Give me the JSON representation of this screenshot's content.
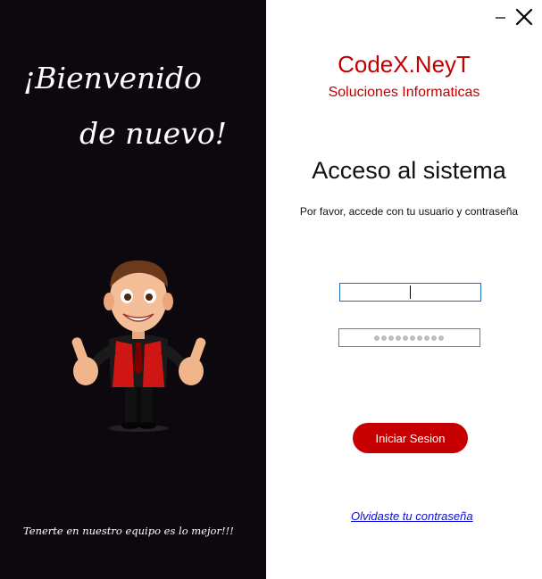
{
  "welcome": {
    "line1": "¡Bienvenido",
    "line2": "de nuevo!"
  },
  "tagline": "Tenerte en nuestro equipo es lo mejor!!!",
  "window": {
    "minimize_icon": "minimize-icon",
    "close_icon": "close-icon"
  },
  "brand": {
    "name": "CodeX.NeyT",
    "subtitle": "Soluciones Informaticas"
  },
  "form": {
    "title": "Acceso al sistema",
    "instruction": "Por favor, accede con tu usuario y contraseña",
    "username_value": "",
    "password_mask_length": 10,
    "login_label": "Iniciar Sesion",
    "forgot_label": "Olvidaste tu contraseña"
  },
  "colors": {
    "panel_bg": "#0c080e",
    "accent": "#c60000",
    "link": "#0b0bd6"
  }
}
